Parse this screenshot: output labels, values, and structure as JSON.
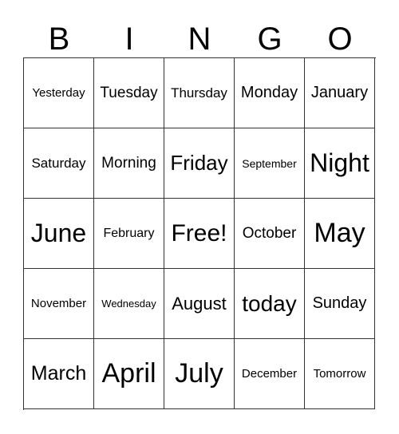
{
  "header": [
    "B",
    "I",
    "N",
    "G",
    "O"
  ],
  "cells": [
    {
      "text": "Yesterday",
      "size": 15
    },
    {
      "text": "Tuesday",
      "size": 19
    },
    {
      "text": "Thursday",
      "size": 17
    },
    {
      "text": "Monday",
      "size": 20
    },
    {
      "text": "January",
      "size": 20
    },
    {
      "text": "Saturday",
      "size": 17
    },
    {
      "text": "Morning",
      "size": 19
    },
    {
      "text": "Friday",
      "size": 26
    },
    {
      "text": "September",
      "size": 14
    },
    {
      "text": "Night",
      "size": 32
    },
    {
      "text": "June",
      "size": 32
    },
    {
      "text": "February",
      "size": 16
    },
    {
      "text": "Free!",
      "size": 30
    },
    {
      "text": "October",
      "size": 19
    },
    {
      "text": "May",
      "size": 34
    },
    {
      "text": "November",
      "size": 15
    },
    {
      "text": "Wednesday",
      "size": 13
    },
    {
      "text": "August",
      "size": 22
    },
    {
      "text": "today",
      "size": 28
    },
    {
      "text": "Sunday",
      "size": 20
    },
    {
      "text": "March",
      "size": 25
    },
    {
      "text": "April",
      "size": 34
    },
    {
      "text": "July",
      "size": 34
    },
    {
      "text": "December",
      "size": 15
    },
    {
      "text": "Tomorrow",
      "size": 15
    }
  ]
}
